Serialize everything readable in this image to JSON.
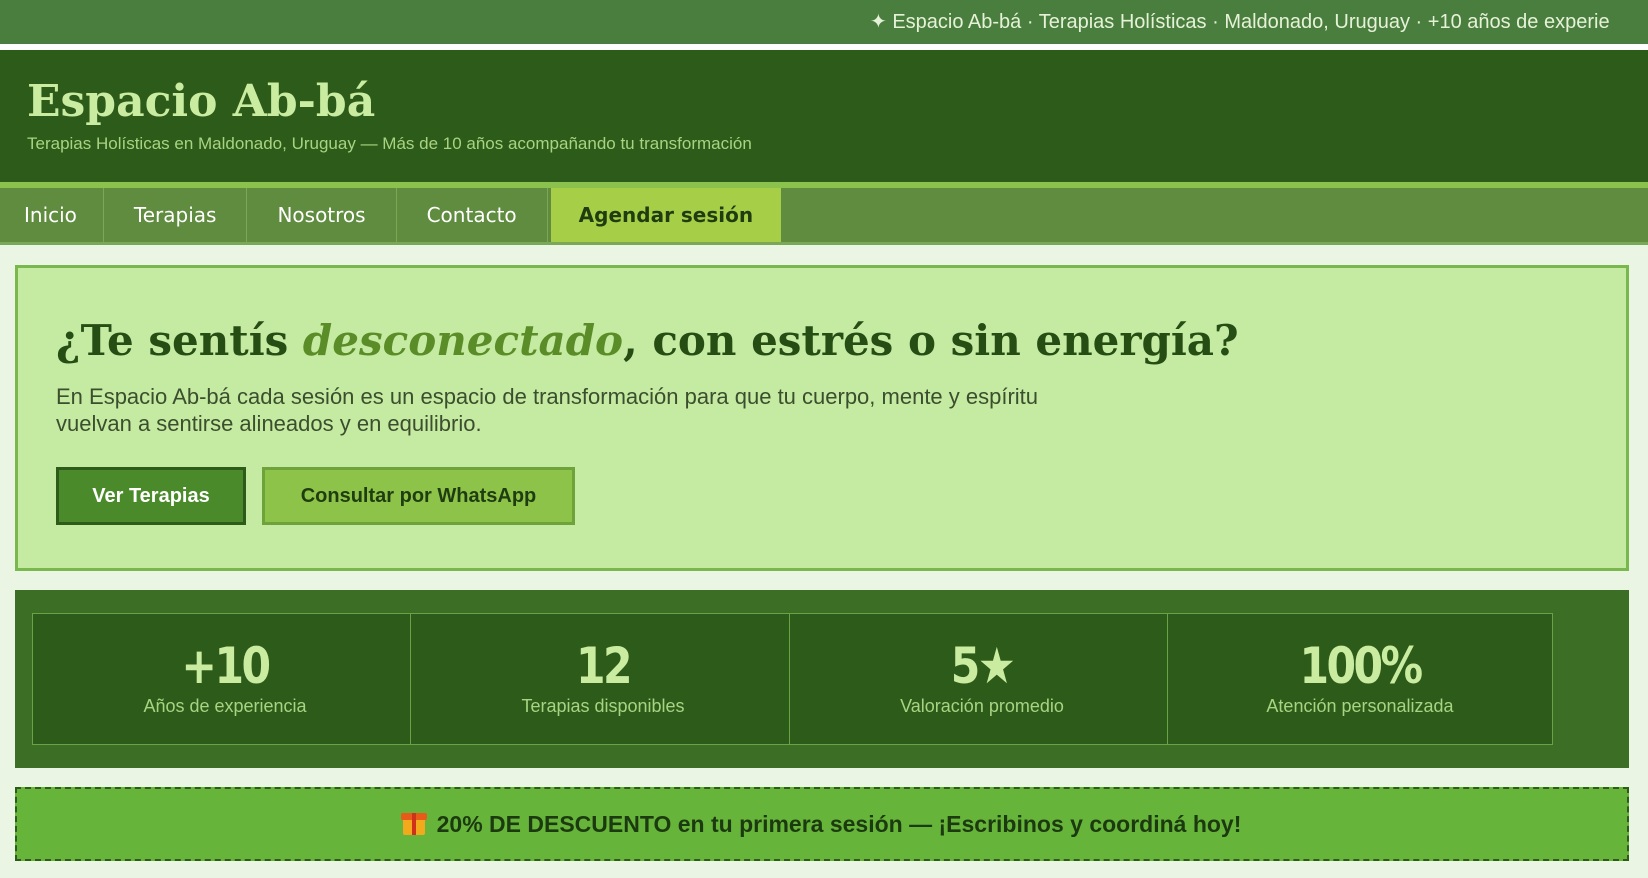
{
  "ticker": {
    "text": "✦ Espacio Ab-bá · Terapias Holísticas · Maldonado, Uruguay · +10 años de experie"
  },
  "header": {
    "title": "Espacio Ab-bá",
    "tagline": "Terapias Holísticas en Maldonado, Uruguay — Más de 10 años acompañando tu transformación"
  },
  "nav": {
    "items": [
      {
        "label": "Inicio"
      },
      {
        "label": "Terapias"
      },
      {
        "label": "Nosotros"
      },
      {
        "label": "Contacto"
      }
    ],
    "cta": {
      "label": "Agendar sesión"
    }
  },
  "hero": {
    "title_before": "¿Te sentís ",
    "title_emphasis": "desconectado",
    "title_after": ", con estrés o sin energía?",
    "text": "En Espacio Ab-bá cada sesión es un espacio de transformación para que tu cuerpo, mente y espíritu vuelvan a sentirse alineados y en equilibrio.",
    "primary_button": "Ver Terapias",
    "secondary_button": "Consultar por WhatsApp"
  },
  "stats": [
    {
      "value": "+10",
      "label": "Años de experiencia"
    },
    {
      "value": "12",
      "label": "Terapias disponibles"
    },
    {
      "value": "5★",
      "label": "Valoración promedio"
    },
    {
      "value": "100%",
      "label": "Atención personalizada"
    }
  ],
  "promo": {
    "icon": "gift-icon",
    "text": "20% DE DESCUENTO en tu primera sesión — ¡Escribinos y coordiná hoy!"
  },
  "colors": {
    "brand_dark": "#2d5b19",
    "accent": "#a6cf47",
    "hero_bg": "#c5eaa1",
    "promo_bg": "#67b43b"
  }
}
